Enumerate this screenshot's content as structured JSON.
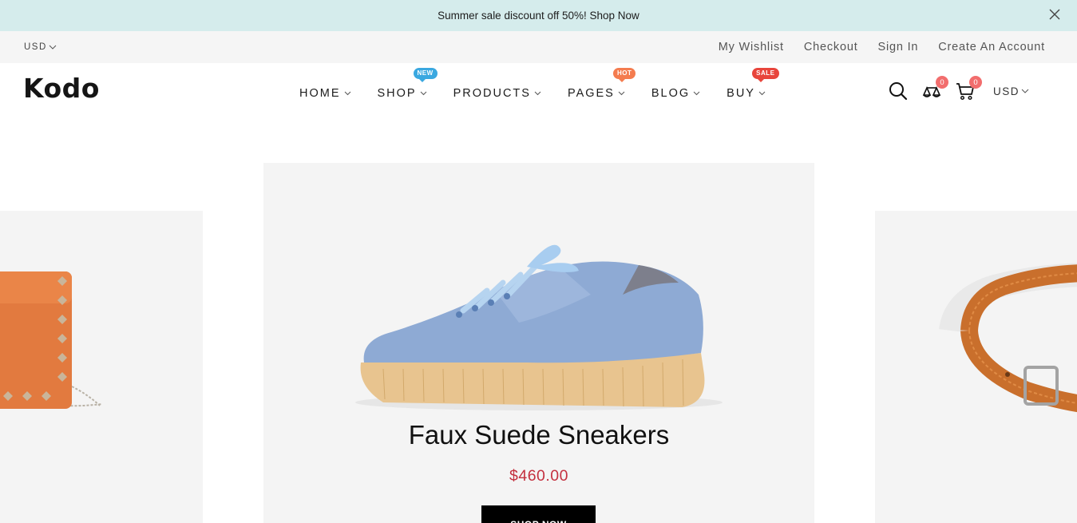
{
  "announcement": {
    "text": "Summer sale discount off 50%! Shop Now"
  },
  "topbar": {
    "currency": "USD",
    "links": [
      "My Wishlist",
      "Checkout",
      "Sign In",
      "Create An Account"
    ]
  },
  "header": {
    "logo": "Kodo",
    "nav": [
      {
        "label": "HOME",
        "badge": ""
      },
      {
        "label": "SHOP",
        "badge": "NEW"
      },
      {
        "label": "PRODUCTS",
        "badge": ""
      },
      {
        "label": "PAGES",
        "badge": "HOT"
      },
      {
        "label": "BLOG",
        "badge": ""
      },
      {
        "label": "BUY",
        "badge": "SALE"
      }
    ],
    "wishlist_count": "0",
    "cart_count": "0",
    "currency": "USD",
    "icons": [
      "search-icon",
      "compare-icon",
      "cart-icon"
    ]
  },
  "slider": {
    "main": {
      "title": "Faux Suede Sneakers",
      "price": "$460.00",
      "button": "SHOP NOW"
    }
  },
  "colors": {
    "announcement_bg": "#d5ecec",
    "topbar_bg": "#f5f5f5",
    "badge_new": "#3aa8e0",
    "badge_hot": "#f47c4f",
    "badge_sale": "#e8453c",
    "count_bg": "#f26d6d",
    "price": "#c4303f"
  }
}
